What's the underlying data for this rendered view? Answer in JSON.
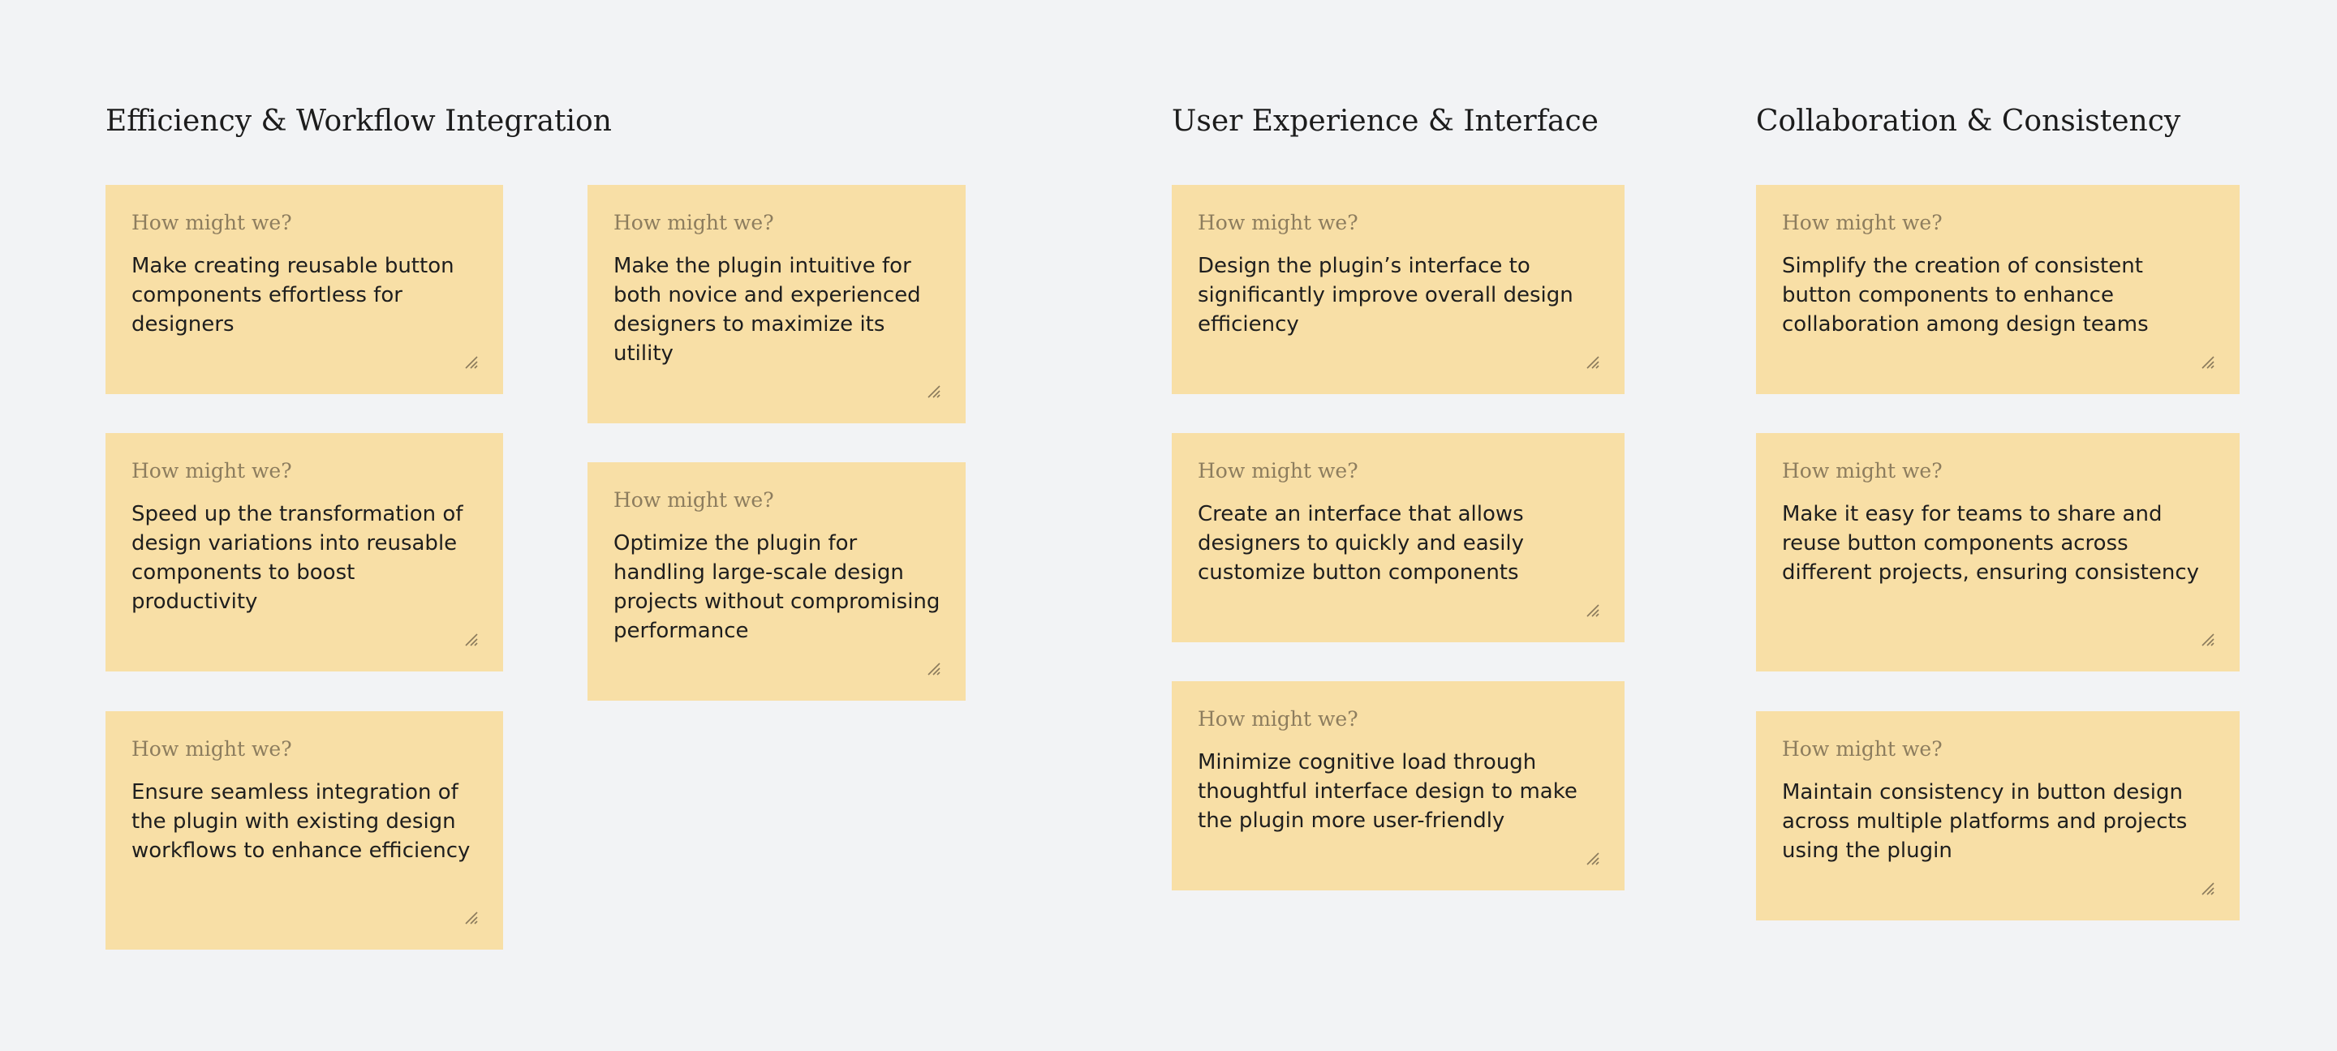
{
  "groups": [
    {
      "title": "Efficiency & Workflow Integration",
      "columns": [
        [
          {
            "prompt": "How might we?",
            "text": "Make creating reusable button components effortless for designers"
          },
          {
            "prompt": "How might we?",
            "text": "Speed up the transformation of design variations into reusable components to boost productivity"
          },
          {
            "prompt": "How might we?",
            "text": "Ensure seamless integration of the plugin with existing design workflows to enhance efficiency"
          }
        ],
        [
          {
            "prompt": "How might we?",
            "text": "Make the plugin intuitive for both novice and experienced designers to maximize its utility"
          },
          {
            "prompt": "How might we?",
            "text": "Optimize the plugin for handling large-scale design projects without compromising performance"
          }
        ]
      ]
    },
    {
      "title": "User Experience & Interface",
      "columns": [
        [
          {
            "prompt": "How might we?",
            "text": "Design the plugin’s interface to significantly improve overall design efficiency"
          },
          {
            "prompt": "How might we?",
            "text": "Create an interface that allows designers to quickly and easily customize button components"
          },
          {
            "prompt": "How might we?",
            "text": "Minimize cognitive load through thoughtful interface design to make the plugin more user-friendly"
          }
        ]
      ]
    },
    {
      "title": "Collaboration & Consistency",
      "columns": [
        [
          {
            "prompt": "How might we?",
            "text": "Simplify the creation of consistent button components to enhance collaboration among design teams"
          },
          {
            "prompt": "How might we?",
            "text": "Make it easy for teams to share and reuse button components across different projects, ensuring consistency"
          },
          {
            "prompt": "How might we?",
            "text": "Maintain consistency in button design across multiple platforms and projects using the plugin"
          }
        ]
      ]
    }
  ],
  "colors": {
    "background": "#f2f3f5",
    "sticky_note": "#f8dfa6",
    "prompt_text": "#8d7d5e",
    "body_text": "#1e1e1e"
  },
  "icons": {
    "resize_grip": "resize-grip-icon"
  }
}
